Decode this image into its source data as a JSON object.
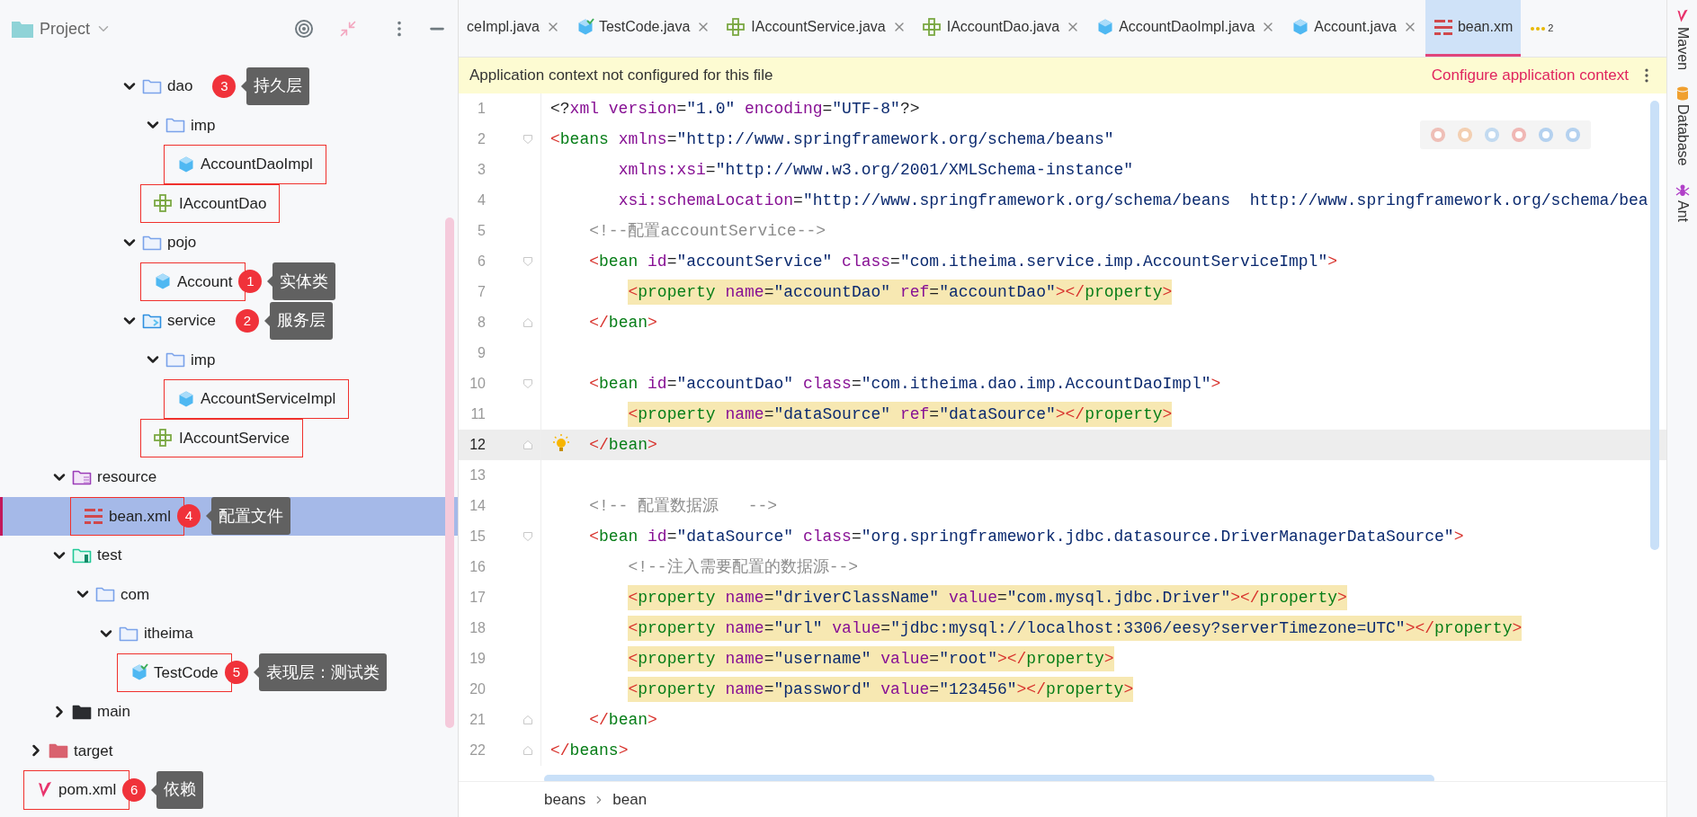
{
  "project_panel": {
    "title": "Project"
  },
  "tree": [
    {
      "children": [
        {
          "children": [
            {
              "children": [
                {
                  "children": [
                    {
                      "label": "dao",
                      "kind": "folder",
                      "expanded": true,
                      "selected": false,
                      "outlined": false,
                      "note": {
                        "number": "3",
                        "text": "持久层"
                      },
                      "children": [
                        {
                          "label": "imp",
                          "kind": "folder",
                          "expanded": true,
                          "selected": false,
                          "outlined": false,
                          "children": [
                            {
                              "label": "AccountDaoImpl",
                              "kind": "class",
                              "selected": false,
                              "outlined": true
                            }
                          ]
                        },
                        {
                          "label": "IAccountDao",
                          "kind": "interface",
                          "selected": false,
                          "outlined": true
                        }
                      ]
                    },
                    {
                      "label": "pojo",
                      "kind": "folder",
                      "expanded": true,
                      "selected": false,
                      "outlined": false,
                      "children": [
                        {
                          "label": "Account",
                          "kind": "class",
                          "selected": false,
                          "outlined": true,
                          "note": {
                            "number": "1",
                            "text": "实体类"
                          }
                        }
                      ]
                    },
                    {
                      "label": "service",
                      "kind": "service-folder",
                      "expanded": true,
                      "selected": false,
                      "outlined": false,
                      "note": {
                        "number": "2",
                        "text": "服务层"
                      },
                      "children": [
                        {
                          "label": "imp",
                          "kind": "folder",
                          "expanded": true,
                          "selected": false,
                          "outlined": false,
                          "children": [
                            {
                              "label": "AccountServiceImpl",
                              "kind": "class",
                              "selected": false,
                              "outlined": true
                            }
                          ]
                        },
                        {
                          "label": "IAccountService",
                          "kind": "interface",
                          "selected": false,
                          "outlined": true
                        }
                      ]
                    }
                  ]
                }
              ]
            }
          ]
        },
        {
          "label": "resource",
          "kind": "resource-folder",
          "expanded": true,
          "selected": false,
          "outlined": false,
          "children": [
            {
              "label": "bean.xml",
              "kind": "xml",
              "selected": true,
              "outlined": true,
              "note": {
                "number": "4",
                "text": "配置文件"
              }
            }
          ]
        },
        {
          "label": "test",
          "kind": "test-folder",
          "expanded": true,
          "selected": false,
          "outlined": false,
          "children": [
            {
              "label": "com",
              "kind": "folder",
              "expanded": true,
              "selected": false,
              "outlined": false,
              "children": [
                {
                  "label": "itheima",
                  "kind": "folder",
                  "expanded": true,
                  "selected": false,
                  "outlined": false,
                  "children": [
                    {
                      "label": "TestCode",
                      "kind": "test-class",
                      "selected": false,
                      "outlined": true,
                      "note": {
                        "number": "5",
                        "text": "表现层：测试类"
                      }
                    }
                  ]
                }
              ]
            }
          ]
        },
        {
          "label": "main",
          "kind": "source-folder",
          "expanded": false,
          "selected": false,
          "outlined": false
        }
      ]
    },
    {
      "label": "target",
      "kind": "excluded-folder",
      "expanded": false,
      "selected": false,
      "outlined": false
    },
    {
      "label": "pom.xml",
      "kind": "maven",
      "selected": false,
      "outlined": true,
      "note": {
        "number": "6",
        "text": "依赖"
      }
    }
  ],
  "tabs": [
    {
      "label": "ceImpl.java",
      "kind": "none",
      "selected": false
    },
    {
      "label": "TestCode.java",
      "kind": "test-class",
      "selected": false
    },
    {
      "label": "IAccountService.java",
      "kind": "interface",
      "selected": false
    },
    {
      "label": "IAccountDao.java",
      "kind": "interface",
      "selected": false
    },
    {
      "label": "AccountDaoImpl.java",
      "kind": "class",
      "selected": false
    },
    {
      "label": "Account.java",
      "kind": "class",
      "selected": false
    },
    {
      "label": "bean.xm",
      "kind": "xml",
      "selected": true
    }
  ],
  "hidden_tabs": {
    "count": "2"
  },
  "banner": {
    "text": "Application context not configured for this file",
    "link": "Configure application context"
  },
  "code": [
    {
      "n": "1",
      "current": false,
      "highlighted": false,
      "fold_start": false,
      "fold_end": false,
      "bulb": false,
      "tokens": [
        {
          "kind": "plain",
          "text": "<?"
        },
        {
          "kind": "attr",
          "text": "xml version"
        },
        {
          "kind": "plain",
          "text": "="
        },
        {
          "kind": "str",
          "text": "\"1.0\""
        },
        {
          "kind": "attr",
          "text": " encoding"
        },
        {
          "kind": "plain",
          "text": "="
        },
        {
          "kind": "str",
          "text": "\"UTF-8\""
        },
        {
          "kind": "plain",
          "text": "?>"
        }
      ]
    },
    {
      "n": "2",
      "current": false,
      "highlighted": false,
      "fold_start": true,
      "fold_end": false,
      "bulb": false,
      "tokens": [
        {
          "kind": "punct",
          "text": "<"
        },
        {
          "kind": "tag",
          "text": "beans"
        },
        {
          "kind": "attr",
          "text": " xmlns"
        },
        {
          "kind": "plain",
          "text": "="
        },
        {
          "kind": "str",
          "text": "\"http://www.springframework.org/schema/beans\""
        }
      ]
    },
    {
      "n": "3",
      "current": false,
      "highlighted": false,
      "fold_start": false,
      "fold_end": false,
      "bulb": false,
      "tokens": [
        {
          "kind": "attr",
          "text": "       xmlns:xsi"
        },
        {
          "kind": "plain",
          "text": "="
        },
        {
          "kind": "str",
          "text": "\"http://www.w3.org/2001/XMLSchema-instance\""
        }
      ]
    },
    {
      "n": "4",
      "current": false,
      "highlighted": false,
      "fold_start": false,
      "fold_end": false,
      "bulb": false,
      "tokens": [
        {
          "kind": "attr",
          "text": "       xsi:schemaLocation"
        },
        {
          "kind": "plain",
          "text": "="
        },
        {
          "kind": "str",
          "text": "\"http://www.springframework.org/schema/beans  http://www.springframework.org/schema/bea"
        }
      ]
    },
    {
      "n": "5",
      "current": false,
      "highlighted": false,
      "fold_start": false,
      "fold_end": false,
      "bulb": false,
      "tokens": [
        {
          "kind": "comment",
          "text": "    <!--配置accountService-->"
        }
      ]
    },
    {
      "n": "6",
      "current": false,
      "highlighted": false,
      "fold_start": true,
      "fold_end": false,
      "bulb": false,
      "tokens": [
        {
          "kind": "punct",
          "text": "    <"
        },
        {
          "kind": "tag",
          "text": "bean"
        },
        {
          "kind": "attr",
          "text": " id"
        },
        {
          "kind": "plain",
          "text": "="
        },
        {
          "kind": "str",
          "text": "\"accountService\""
        },
        {
          "kind": "attr",
          "text": " class"
        },
        {
          "kind": "plain",
          "text": "="
        },
        {
          "kind": "str",
          "text": "\"com.itheima.service.imp.AccountServiceImpl\""
        },
        {
          "kind": "punct",
          "text": ">"
        }
      ]
    },
    {
      "n": "7",
      "current": false,
      "highlighted": true,
      "fold_start": false,
      "fold_end": false,
      "bulb": false,
      "tokens": [
        {
          "kind": "punct",
          "text": "        <"
        },
        {
          "kind": "tag",
          "text": "property"
        },
        {
          "kind": "attr",
          "text": " name"
        },
        {
          "kind": "plain",
          "text": "="
        },
        {
          "kind": "str",
          "text": "\"accountDao\""
        },
        {
          "kind": "attr",
          "text": " ref"
        },
        {
          "kind": "plain",
          "text": "="
        },
        {
          "kind": "str",
          "text": "\"accountDao\""
        },
        {
          "kind": "punct",
          "text": "></"
        },
        {
          "kind": "tag",
          "text": "property"
        },
        {
          "kind": "punct",
          "text": ">"
        }
      ]
    },
    {
      "n": "8",
      "current": false,
      "highlighted": false,
      "fold_start": false,
      "fold_end": true,
      "bulb": false,
      "tokens": [
        {
          "kind": "punct",
          "text": "    </"
        },
        {
          "kind": "tag",
          "text": "bean"
        },
        {
          "kind": "punct",
          "text": ">"
        }
      ]
    },
    {
      "n": "9",
      "current": false,
      "fold_start": false,
      "fold_end": false,
      "bulb": false
    },
    {
      "n": "10",
      "current": false,
      "highlighted": false,
      "fold_start": true,
      "fold_end": false,
      "bulb": false,
      "tokens": [
        {
          "kind": "punct",
          "text": "    <"
        },
        {
          "kind": "tag",
          "text": "bean"
        },
        {
          "kind": "attr",
          "text": " id"
        },
        {
          "kind": "plain",
          "text": "="
        },
        {
          "kind": "str",
          "text": "\"accountDao\""
        },
        {
          "kind": "attr",
          "text": " class"
        },
        {
          "kind": "plain",
          "text": "="
        },
        {
          "kind": "str",
          "text": "\"com.itheima.dao.imp.AccountDaoImpl\""
        },
        {
          "kind": "punct",
          "text": ">"
        }
      ]
    },
    {
      "n": "11",
      "current": false,
      "highlighted": true,
      "fold_start": false,
      "fold_end": false,
      "bulb": false,
      "tokens": [
        {
          "kind": "punct",
          "text": "        <"
        },
        {
          "kind": "tag",
          "text": "property"
        },
        {
          "kind": "attr",
          "text": " name"
        },
        {
          "kind": "plain",
          "text": "="
        },
        {
          "kind": "str",
          "text": "\"dataSource\""
        },
        {
          "kind": "attr",
          "text": " ref"
        },
        {
          "kind": "plain",
          "text": "="
        },
        {
          "kind": "str",
          "text": "\"dataSource\""
        },
        {
          "kind": "punct",
          "text": "></"
        },
        {
          "kind": "tag",
          "text": "property"
        },
        {
          "kind": "punct",
          "text": ">"
        }
      ]
    },
    {
      "n": "12",
      "current": true,
      "highlighted": false,
      "fold_start": false,
      "fold_end": true,
      "bulb": true,
      "tokens": [
        {
          "kind": "punct",
          "text": "    </"
        },
        {
          "kind": "tag",
          "text": "bean"
        },
        {
          "kind": "punct",
          "text": ">"
        }
      ]
    },
    {
      "n": "13",
      "current": false,
      "fold_start": false,
      "fold_end": false,
      "bulb": false
    },
    {
      "n": "14",
      "current": false,
      "highlighted": false,
      "fold_start": false,
      "fold_end": false,
      "bulb": false,
      "tokens": [
        {
          "kind": "comment",
          "text": "    <!-- 配置数据源   -->"
        }
      ]
    },
    {
      "n": "15",
      "current": false,
      "highlighted": false,
      "fold_start": true,
      "fold_end": false,
      "bulb": false,
      "tokens": [
        {
          "kind": "punct",
          "text": "    <"
        },
        {
          "kind": "tag",
          "text": "bean"
        },
        {
          "kind": "attr",
          "text": " id"
        },
        {
          "kind": "plain",
          "text": "="
        },
        {
          "kind": "str",
          "text": "\"dataSource\""
        },
        {
          "kind": "attr",
          "text": " class"
        },
        {
          "kind": "plain",
          "text": "="
        },
        {
          "kind": "str",
          "text": "\"org.springframework.jdbc.datasource.DriverManagerDataSource\""
        },
        {
          "kind": "punct",
          "text": ">"
        }
      ]
    },
    {
      "n": "16",
      "current": false,
      "highlighted": false,
      "fold_start": false,
      "fold_end": false,
      "bulb": false,
      "tokens": [
        {
          "kind": "comment",
          "text": "        <!--注入需要配置的数据源-->"
        }
      ]
    },
    {
      "n": "17",
      "current": false,
      "highlighted": true,
      "fold_start": false,
      "fold_end": false,
      "bulb": false,
      "tokens": [
        {
          "kind": "punct",
          "text": "        <"
        },
        {
          "kind": "tag",
          "text": "property"
        },
        {
          "kind": "attr",
          "text": " name"
        },
        {
          "kind": "plain",
          "text": "="
        },
        {
          "kind": "str",
          "text": "\"driverClassName\""
        },
        {
          "kind": "attr",
          "text": " value"
        },
        {
          "kind": "plain",
          "text": "="
        },
        {
          "kind": "str",
          "text": "\"com.mysql.jdbc.Driver\""
        },
        {
          "kind": "punct",
          "text": "></"
        },
        {
          "kind": "tag",
          "text": "property"
        },
        {
          "kind": "punct",
          "text": ">"
        }
      ]
    },
    {
      "n": "18",
      "current": false,
      "highlighted": true,
      "fold_start": false,
      "fold_end": false,
      "bulb": false,
      "tokens": [
        {
          "kind": "punct",
          "text": "        <"
        },
        {
          "kind": "tag",
          "text": "property"
        },
        {
          "kind": "attr",
          "text": " name"
        },
        {
          "kind": "plain",
          "text": "="
        },
        {
          "kind": "str",
          "text": "\"url\""
        },
        {
          "kind": "attr",
          "text": " value"
        },
        {
          "kind": "plain",
          "text": "="
        },
        {
          "kind": "str",
          "text": "\"jdbc:mysql://localhost:3306/eesy?serverTimezone=UTC\""
        },
        {
          "kind": "punct",
          "text": "></"
        },
        {
          "kind": "tag",
          "text": "property"
        },
        {
          "kind": "punct",
          "text": ">"
        }
      ]
    },
    {
      "n": "19",
      "current": false,
      "highlighted": true,
      "fold_start": false,
      "fold_end": false,
      "bulb": false,
      "tokens": [
        {
          "kind": "punct",
          "text": "        <"
        },
        {
          "kind": "tag",
          "text": "property"
        },
        {
          "kind": "attr",
          "text": " name"
        },
        {
          "kind": "plain",
          "text": "="
        },
        {
          "kind": "str",
          "text": "\"username\""
        },
        {
          "kind": "attr",
          "text": " value"
        },
        {
          "kind": "plain",
          "text": "="
        },
        {
          "kind": "str",
          "text": "\"root\""
        },
        {
          "kind": "punct",
          "text": "></"
        },
        {
          "kind": "tag",
          "text": "property"
        },
        {
          "kind": "punct",
          "text": ">"
        }
      ]
    },
    {
      "n": "20",
      "current": false,
      "highlighted": true,
      "fold_start": false,
      "fold_end": false,
      "bulb": false,
      "tokens": [
        {
          "kind": "punct",
          "text": "        <"
        },
        {
          "kind": "tag",
          "text": "property"
        },
        {
          "kind": "attr",
          "text": " name"
        },
        {
          "kind": "plain",
          "text": "="
        },
        {
          "kind": "str",
          "text": "\"password\""
        },
        {
          "kind": "attr",
          "text": " value"
        },
        {
          "kind": "plain",
          "text": "="
        },
        {
          "kind": "str",
          "text": "\"123456\""
        },
        {
          "kind": "punct",
          "text": "></"
        },
        {
          "kind": "tag",
          "text": "property"
        },
        {
          "kind": "punct",
          "text": ">"
        }
      ]
    },
    {
      "n": "21",
      "current": false,
      "highlighted": false,
      "fold_start": false,
      "fold_end": true,
      "bulb": false,
      "tokens": [
        {
          "kind": "punct",
          "text": "    </"
        },
        {
          "kind": "tag",
          "text": "bean"
        },
        {
          "kind": "punct",
          "text": ">"
        }
      ]
    },
    {
      "n": "22",
      "current": false,
      "highlighted": false,
      "fold_start": false,
      "fold_end": true,
      "bulb": false,
      "tokens": [
        {
          "kind": "punct",
          "text": "</"
        },
        {
          "kind": "tag",
          "text": "beans"
        },
        {
          "kind": "punct",
          "text": ">"
        }
      ]
    }
  ],
  "breadcrumb": [
    "beans",
    "bean"
  ],
  "tool_windows": [
    {
      "label": "Maven",
      "kind": "maven"
    },
    {
      "label": "Database",
      "kind": "database"
    },
    {
      "label": "Ant",
      "kind": "ant"
    }
  ]
}
